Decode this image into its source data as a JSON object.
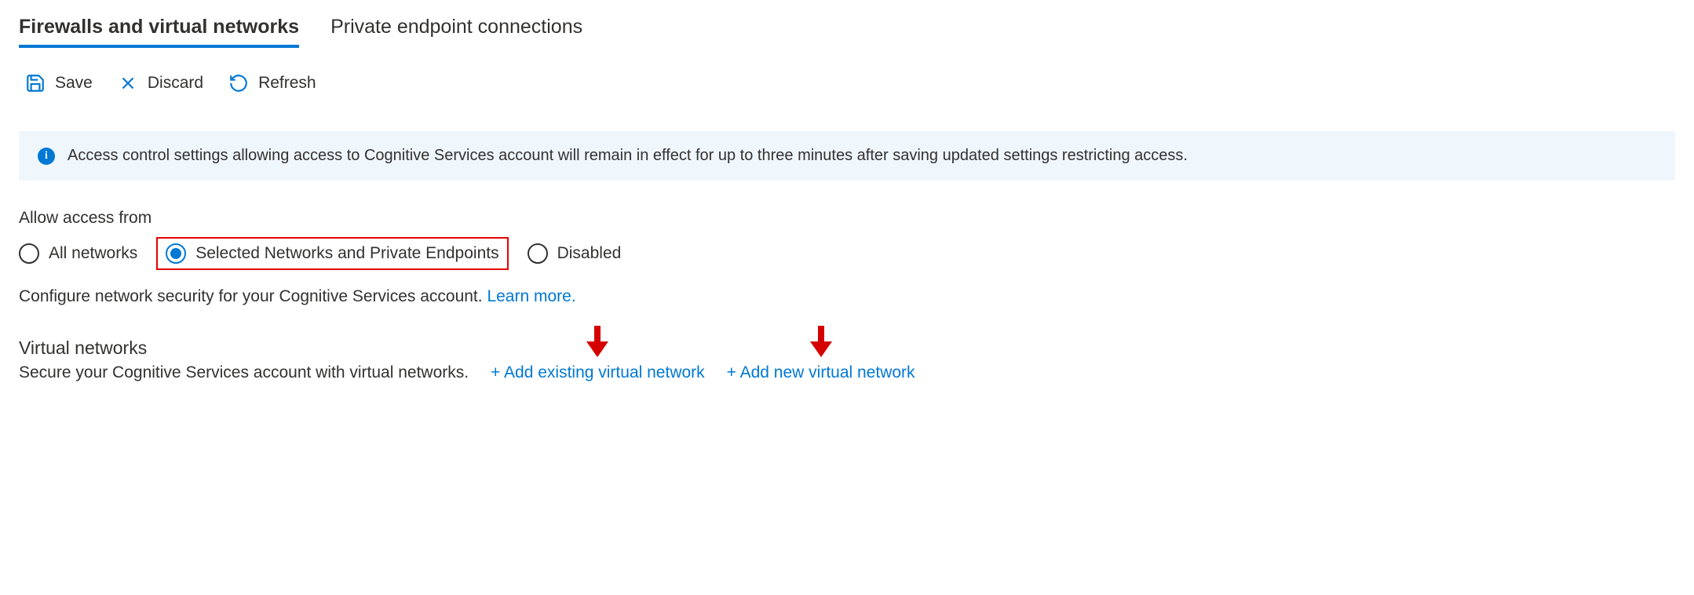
{
  "tabs": {
    "firewalls": "Firewalls and virtual networks",
    "private_endpoints": "Private endpoint connections"
  },
  "toolbar": {
    "save": "Save",
    "discard": "Discard",
    "refresh": "Refresh"
  },
  "info_banner": {
    "text": "Access control settings allowing access to Cognitive Services account will remain in effect for up to three minutes after saving updated settings restricting access."
  },
  "access": {
    "label": "Allow access from",
    "options": {
      "all": "All networks",
      "selected": "Selected Networks and Private Endpoints",
      "disabled": "Disabled"
    },
    "helper_prefix": "Configure network security for your Cognitive Services account. ",
    "learn_more": "Learn more."
  },
  "vnet": {
    "heading": "Virtual networks",
    "desc": "Secure your Cognitive Services account with virtual networks.",
    "add_existing": "+ Add existing virtual network",
    "add_new": "+ Add new virtual network"
  }
}
